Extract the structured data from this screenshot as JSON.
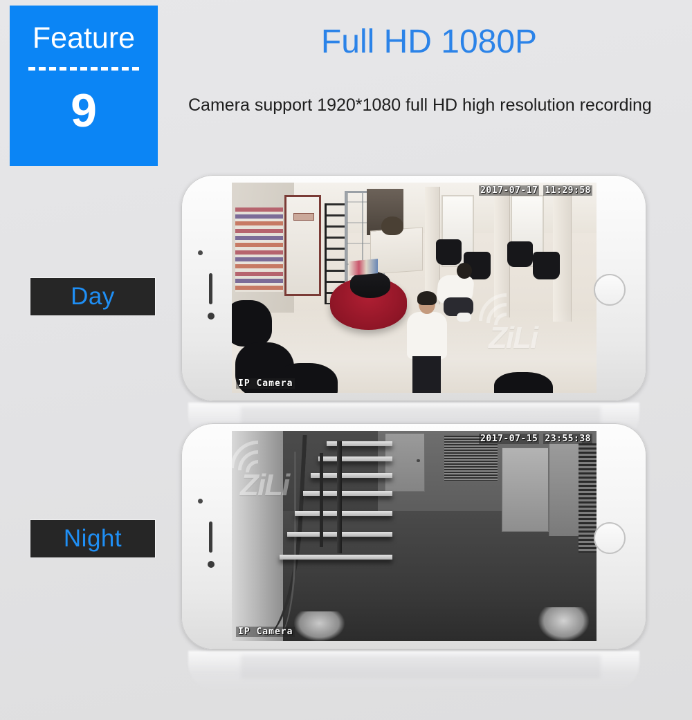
{
  "background_color": "#e5e5e7",
  "badge": {
    "label": "Feature",
    "number": "9",
    "color": "#0b85f5",
    "divider_icon": "dashed-divider-icon"
  },
  "headline": {
    "text": "Full HD 1080P",
    "color": "#2b83e8"
  },
  "description": {
    "text": "Camera support 1920*1080 full HD high resolution recording"
  },
  "modes": [
    {
      "id": "day",
      "label": "Day",
      "text_color": "#1f8ff5",
      "background_color": "#262626"
    },
    {
      "id": "night",
      "label": "Night",
      "text_color": "#1f8ff5",
      "background_color": "#262626"
    }
  ],
  "devices": [
    {
      "id": "phone-day",
      "form_factor": "smartphone-landscape",
      "body_color": "#f4f4f4",
      "hardware": {
        "home_button": "home-button-icon",
        "earpiece_speaker": "speaker-slit-icon",
        "front_camera": "front-camera-icon",
        "proximity_sensor": "proximity-sensor-icon"
      },
      "screen": {
        "feed_type": "color-daylight",
        "scene": "hair salon interior with red circular sofa, styling chairs and mirrors",
        "osd": {
          "date": "2017-07-17",
          "time": "11:29:58",
          "channel_name": "IP Camera"
        },
        "watermark": {
          "text": "ZiLi",
          "icon": "wifi-signal-icon"
        }
      }
    },
    {
      "id": "phone-night",
      "form_factor": "smartphone-landscape",
      "body_color": "#f4f4f4",
      "hardware": {
        "home_button": "home-button-icon",
        "earpiece_speaker": "speaker-slit-icon",
        "front_camera": "front-camera-icon",
        "proximity_sensor": "proximity-sensor-icon"
      },
      "screen": {
        "feed_type": "infrared-grayscale",
        "scene": "indoor staircase and hallway at night in black and white night vision",
        "osd": {
          "date": "2017-07-15",
          "time": "23:55:38",
          "channel_name": "IP Camera"
        },
        "watermark": {
          "text": "ZiLi",
          "icon": "wifi-signal-icon"
        }
      }
    }
  ]
}
